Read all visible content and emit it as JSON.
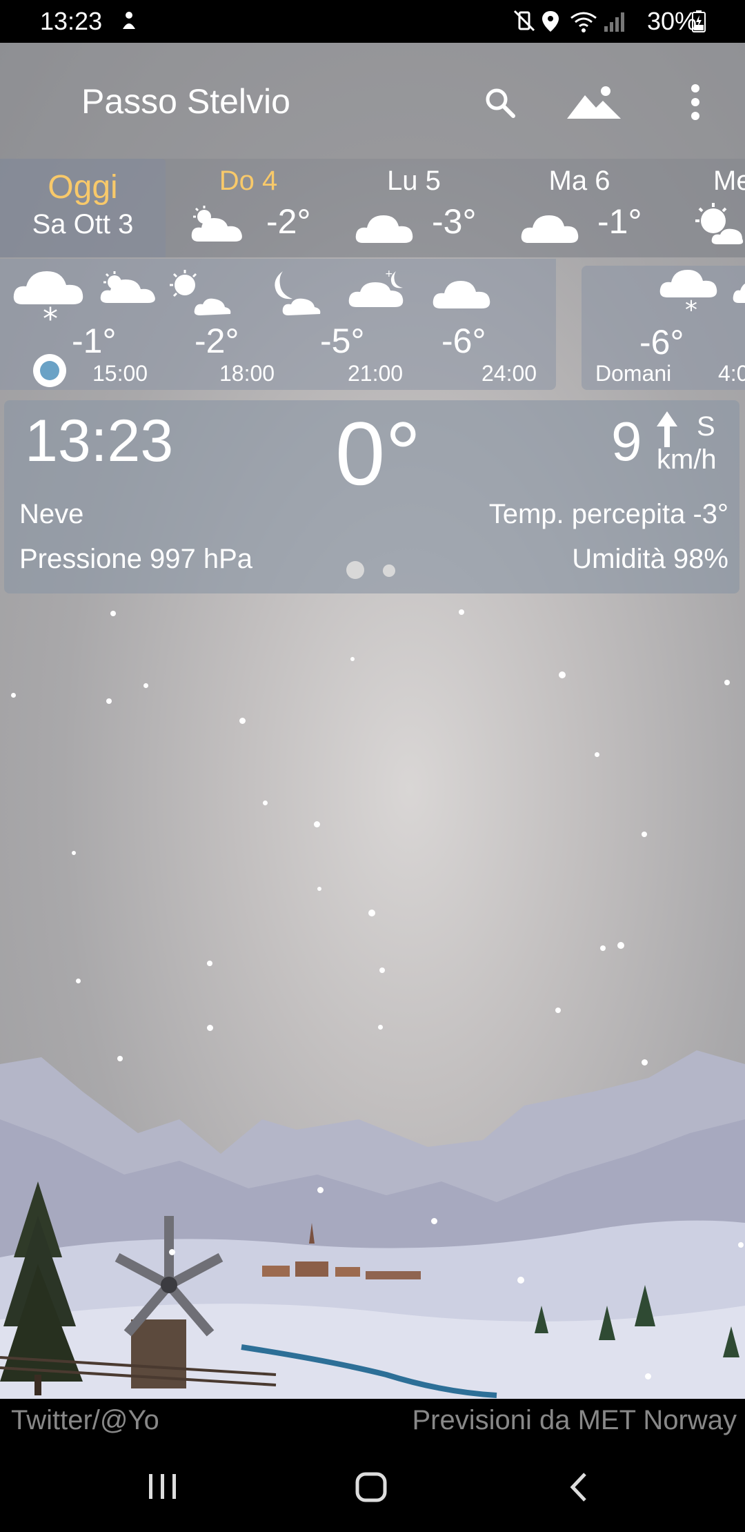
{
  "status": {
    "time": "13:23",
    "battery": "30%"
  },
  "location": {
    "name": "Passo Stelvio"
  },
  "days": [
    {
      "name": "Oggi",
      "date": "Sa Ott 3",
      "selected": true
    },
    {
      "name": "Do 4",
      "temp": "-2°",
      "icon": "cloud-sun-icon",
      "highlight": true
    },
    {
      "name": "Lu 5",
      "temp": "-3°",
      "icon": "cloud-icon"
    },
    {
      "name": "Ma 6",
      "temp": "-1°",
      "icon": "cloud-icon"
    },
    {
      "name": "Me",
      "temp": "",
      "icon": "sun-cloud-icon"
    }
  ],
  "hourly": [
    {
      "temp": "-1°",
      "time": "15:00",
      "icon": "snow-cloud-icon"
    },
    {
      "temp": "-2°",
      "time": "18:00",
      "icon": "sun-cloud-icon"
    },
    {
      "temp": "-5°",
      "time": "21:00",
      "icon": "moon-cloud-icon"
    },
    {
      "temp": "-6°",
      "time": "24:00",
      "icon": "cloud-icon"
    }
  ],
  "tomorrow": {
    "temp": "-6°",
    "label": "Domani",
    "next_time": "4:0"
  },
  "now": {
    "time": "13:23",
    "temperature": "0°",
    "wind_speed": "9",
    "wind_dir": "S",
    "wind_unit": "km/h",
    "condition": "Neve",
    "feels_like": "Temp. percepita -3°",
    "pressure": "Pressione 997 hPa",
    "humidity": "Umidità 98%"
  },
  "footer": {
    "left": "Twitter/@Yo",
    "right": "Previsioni da MET Norway"
  },
  "colors": {
    "highlight": "#f8c96a",
    "panel": "#8c96a5"
  }
}
